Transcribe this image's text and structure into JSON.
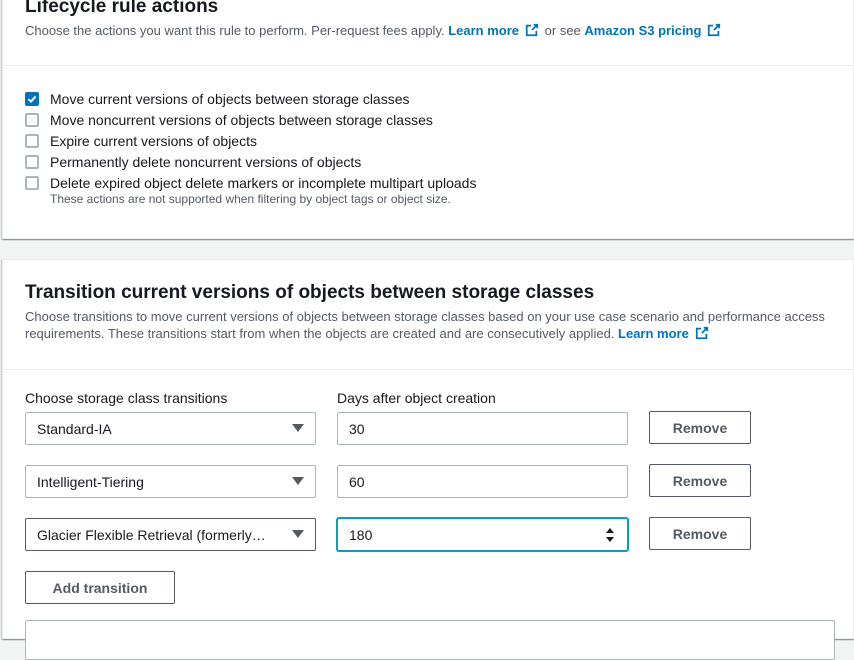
{
  "lifecycle": {
    "title": "Lifecycle rule actions",
    "description": "Choose the actions you want this rule to perform. Per-request fees apply.",
    "learn_more": "Learn more",
    "or_see": "or see",
    "pricing_link": "Amazon S3 pricing",
    "actions": [
      {
        "label": "Move current versions of objects between storage classes",
        "checked": true
      },
      {
        "label": "Move noncurrent versions of objects between storage classes",
        "checked": false
      },
      {
        "label": "Expire current versions of objects",
        "checked": false
      },
      {
        "label": "Permanently delete noncurrent versions of objects",
        "checked": false
      },
      {
        "label": "Delete expired object delete markers or incomplete multipart uploads",
        "checked": false
      }
    ],
    "note": "These actions are not supported when filtering by object tags or object size."
  },
  "transitions": {
    "title": "Transition current versions of objects between storage classes",
    "description": "Choose transitions to move current versions of objects between storage classes based on your use case scenario and performance access requirements. These transitions start from when the objects are created and are consecutively applied.",
    "learn_more": "Learn more",
    "col_storage_class": "Choose storage class transitions",
    "col_days": "Days after object creation",
    "rows": [
      {
        "storage_class": "Standard-IA",
        "days": "30",
        "remove_label": "Remove"
      },
      {
        "storage_class": "Intelligent-Tiering",
        "days": "60",
        "remove_label": "Remove"
      },
      {
        "storage_class": "Glacier Flexible Retrieval (formerly…",
        "days": "180",
        "remove_label": "Remove"
      }
    ],
    "add_label": "Add transition"
  },
  "colors": {
    "link": "#0073bb",
    "checkbox_checked": "#0073bb",
    "focus_ring": "#00a1c9",
    "page_bg": "#f2f3f3"
  },
  "icons": {
    "external_link": "external-link-icon",
    "checkmark": "checkmark-icon",
    "dropdown": "caret-down-icon",
    "spinner": "spinner-arrows-icon"
  }
}
